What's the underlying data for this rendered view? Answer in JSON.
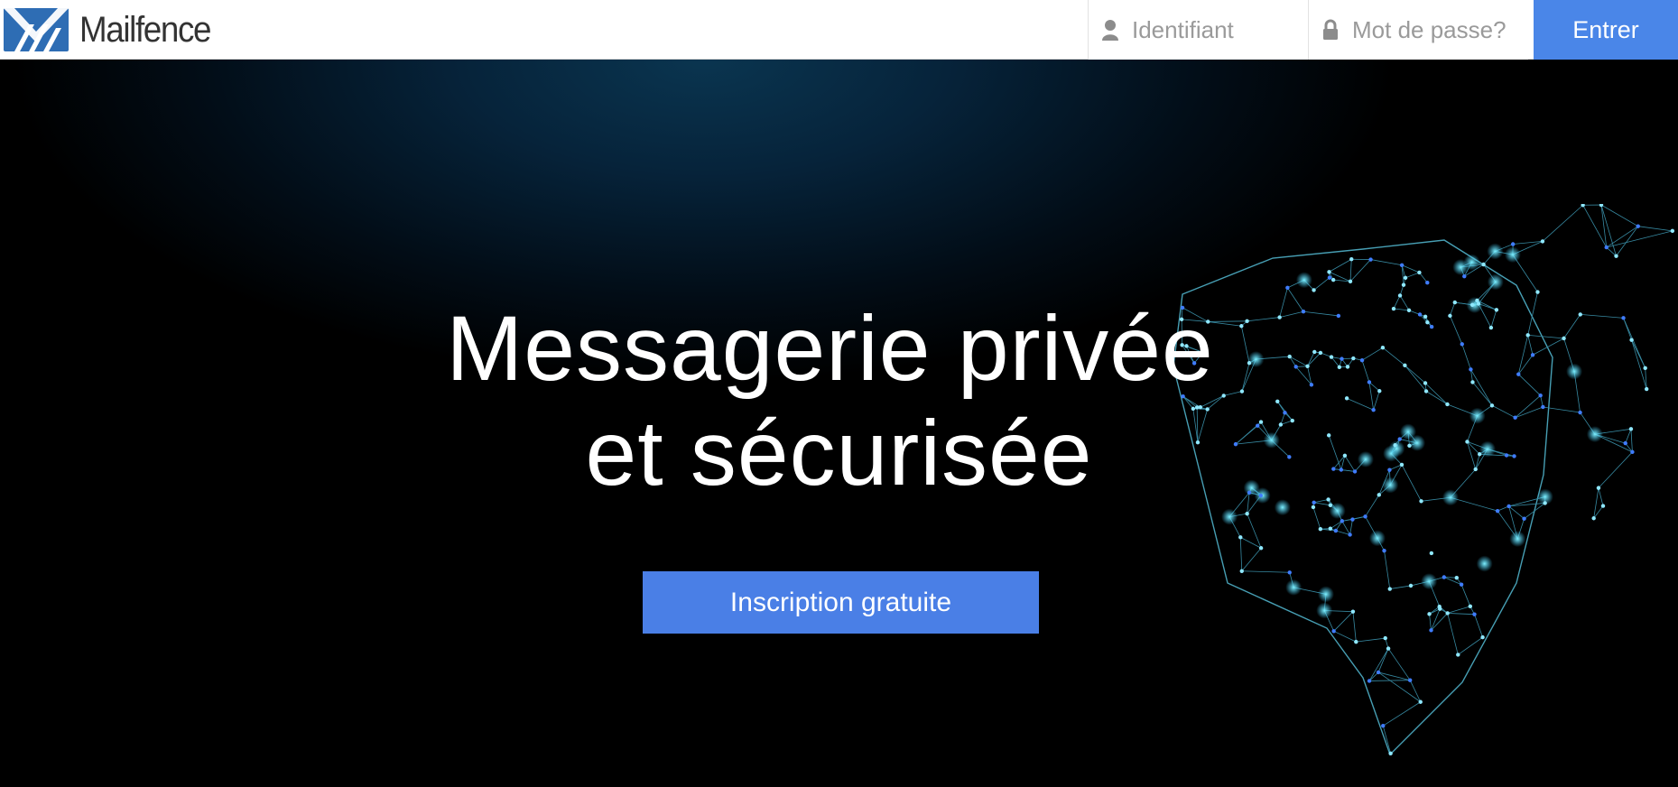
{
  "header": {
    "brand": "Mailfence",
    "login": {
      "username_placeholder": "Identifiant",
      "password_placeholder": "Mot de passe?",
      "submit_label": "Entrer"
    }
  },
  "hero": {
    "headline_line1": "Messagerie privée",
    "headline_line2": "et sécurisée",
    "cta_label": "Inscription gratuite"
  },
  "colors": {
    "accent": "#4a86e8",
    "header_bg": "#ffffff",
    "hero_bg": "#000000",
    "shield_glow": "#3fd0ff"
  },
  "icons": {
    "logo": "mailfence-logo-icon",
    "username": "user-icon",
    "password": "lock-icon",
    "hero_art": "network-shield-icon"
  }
}
